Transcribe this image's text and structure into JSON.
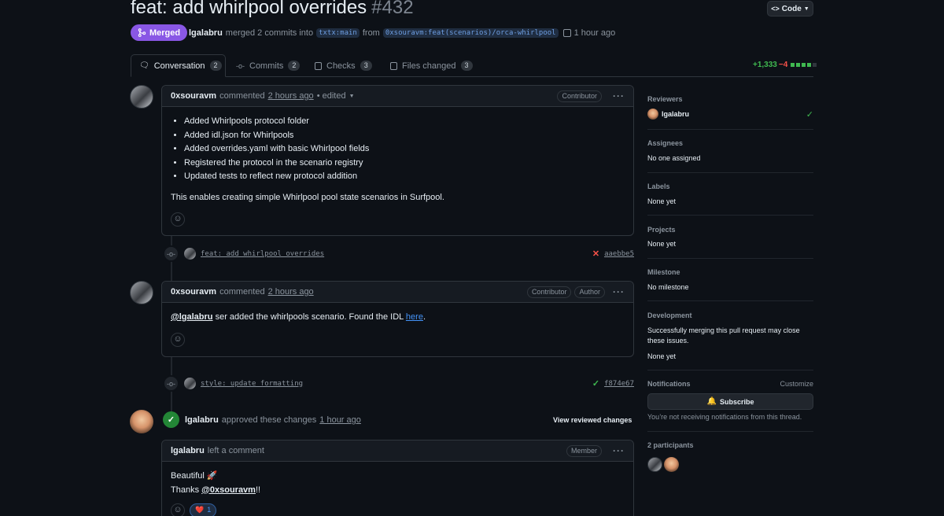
{
  "pr": {
    "title": "feat: add whirlpool overrides",
    "number": "#432",
    "state": "Merged",
    "author": "lgalabru",
    "merged_text": "merged 2 commits into",
    "base_branch": "txtx:main",
    "from_text": "from",
    "head_branch": "0xsouravm:feat(scenarios)/orca-whirlpool",
    "time": "1 hour ago",
    "code_button": "Code"
  },
  "tabs": [
    {
      "label": "Conversation",
      "count": "2"
    },
    {
      "label": "Commits",
      "count": "2"
    },
    {
      "label": "Checks",
      "count": "3"
    },
    {
      "label": "Files changed",
      "count": "3"
    }
  ],
  "diff": {
    "additions": "+1,333",
    "deletions": "−4"
  },
  "comment1": {
    "author": "0xsouravm",
    "action": "commented",
    "time": "2 hours ago",
    "edited": "• edited",
    "badge": "Contributor",
    "items": [
      "Added Whirlpools protocol folder",
      "Added idl.json for Whirlpools",
      "Added overrides.yaml with basic Whirlpool fields",
      "Registered the protocol in the scenario registry",
      "Updated tests to reflect new protocol addition"
    ],
    "paragraph": "This enables creating simple Whirlpool pool state scenarios in Surfpool."
  },
  "commit1": {
    "message": "feat: add whirlpool overrides",
    "sha": "aaebbe5",
    "status": "failure"
  },
  "comment2": {
    "author": "0xsouravm",
    "action": "commented",
    "time": "2 hours ago",
    "badge1": "Contributor",
    "badge2": "Author",
    "mention": "@lgalabru",
    "text": " ser added the whirlpools scenario. Found the IDL ",
    "link": "here",
    "end": "."
  },
  "commit2": {
    "message": "style: update formatting",
    "sha": "f874e67",
    "status": "success"
  },
  "review": {
    "author": "lgalabru",
    "action": "approved these changes",
    "time": "1 hour ago",
    "button": "View reviewed changes"
  },
  "comment3": {
    "author": "lgalabru",
    "action": "left a comment",
    "badge": "Member",
    "line1": "Beautiful 🚀",
    "thanks": "Thanks ",
    "mention": "@0xsouravm",
    "end": "!!",
    "reaction_emoji": "❤️",
    "reaction_count": "1"
  },
  "sidebar": {
    "reviewers_label": "Reviewers",
    "reviewer": "lgalabru",
    "assignees_label": "Assignees",
    "assignees_value": "No one assigned",
    "labels_label": "Labels",
    "labels_value": "None yet",
    "projects_label": "Projects",
    "projects_value": "None yet",
    "milestone_label": "Milestone",
    "milestone_value": "No milestone",
    "development_label": "Development",
    "development_text": "Successfully merging this pull request may close these issues.",
    "development_value": "None yet",
    "notifications_label": "Notifications",
    "customize": "Customize",
    "subscribe": "Subscribe",
    "notif_text": "You’re not receiving notifications from this thread.",
    "participants_label": "2 participants"
  },
  "colors": {
    "merged": "#8957e5",
    "success": "#3fb950",
    "danger": "#f85149",
    "link": "#4493f8"
  }
}
